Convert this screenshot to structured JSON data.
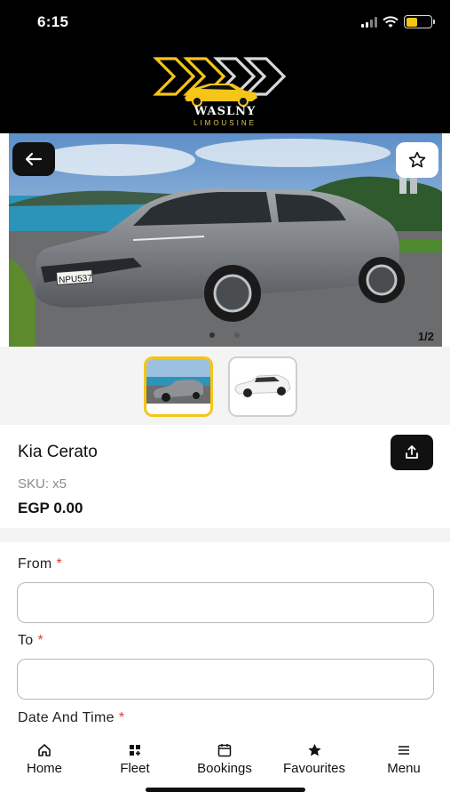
{
  "status_bar": {
    "time": "6:15"
  },
  "brand": {
    "name": "WASLNY",
    "subtitle": "LIMOUSINE"
  },
  "gallery": {
    "counter": "1/2",
    "total_images": 2,
    "current_index": 1,
    "plate_text": "NPU537"
  },
  "product": {
    "title": "Kia Cerato",
    "sku": "SKU: x5",
    "price": "EGP 0.00"
  },
  "form": {
    "from_label": "From",
    "from_value": "",
    "to_label": "To",
    "to_value": "",
    "datetime_label": "Date And Time",
    "required_marker": "*"
  },
  "nav": {
    "items": [
      {
        "label": "Home",
        "icon": "home-icon"
      },
      {
        "label": "Fleet",
        "icon": "grid-icon"
      },
      {
        "label": "Bookings",
        "icon": "calendar-icon"
      },
      {
        "label": "Favourites",
        "icon": "star-icon"
      },
      {
        "label": "Menu",
        "icon": "menu-icon"
      }
    ]
  },
  "colors": {
    "accent": "#f5c518",
    "header_bg": "#000000",
    "required": "#e03b3b"
  }
}
